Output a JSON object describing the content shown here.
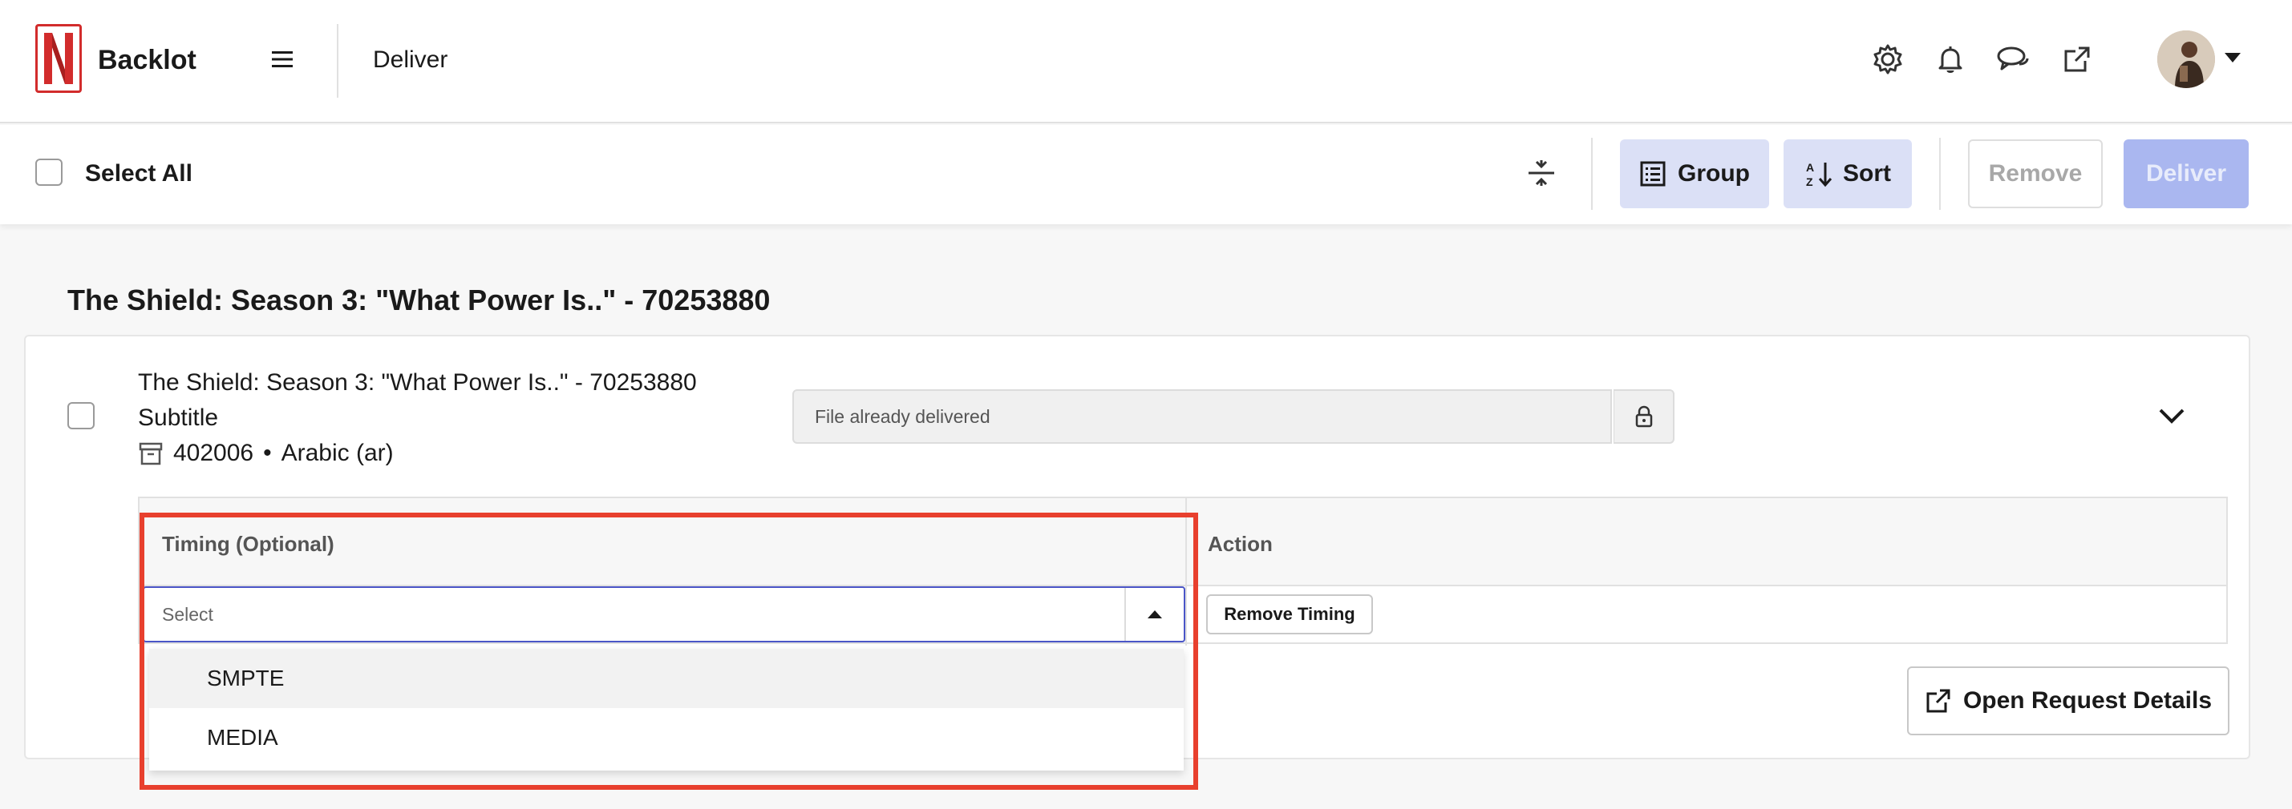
{
  "header": {
    "app_title": "Backlot",
    "page_title": "Deliver",
    "icons": [
      "gear-icon",
      "bell-icon",
      "chat-icon",
      "external-link-icon"
    ],
    "brand_color": "#d22c2c"
  },
  "toolbar": {
    "select_all_label": "Select All",
    "group_label": "Group",
    "sort_label": "Sort",
    "remove_label": "Remove",
    "deliver_label": "Deliver"
  },
  "group": {
    "title": "The Shield: Season 3: \"What Power Is..\" - 70253880"
  },
  "item": {
    "title": "The Shield: Season 3: \"What Power Is..\" - 70253880",
    "type": "Subtitle",
    "id": "402006",
    "separator": "•",
    "language": "Arabic (ar)",
    "status": "File already delivered"
  },
  "table": {
    "col_timing": "Timing (Optional)",
    "col_action": "Action"
  },
  "timing_select": {
    "placeholder": "Select",
    "options": [
      "SMPTE",
      "MEDIA"
    ]
  },
  "actions": {
    "remove_timing": "Remove Timing",
    "open_request_details": "Open Request Details"
  },
  "colors": {
    "accent": "#4a55c7",
    "button_bg": "#dbe0f6",
    "deliver_disabled": "#aab7f0",
    "highlight": "#e8402e"
  }
}
